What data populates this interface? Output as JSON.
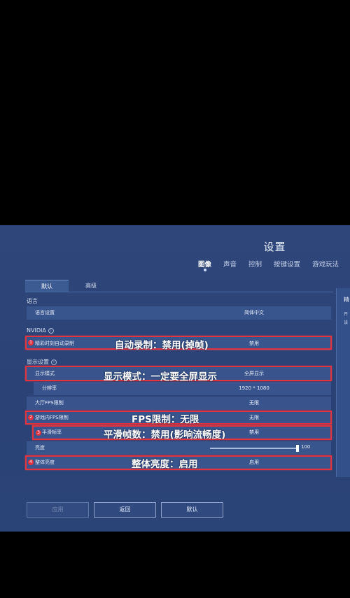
{
  "title": "设置",
  "top_tabs": [
    "图像",
    "声音",
    "控制",
    "按键设置",
    "游戏玩法"
  ],
  "sub_tabs": [
    "默认",
    "高级"
  ],
  "sections": {
    "language": "语言",
    "nvidia": "NVIDIA",
    "display": "显示设置"
  },
  "rows": {
    "language": {
      "label": "语言设置",
      "value": "简体中文"
    },
    "highlight_record": {
      "label": "精彩时刻自动录制",
      "value": "禁用"
    },
    "display_mode": {
      "label": "显示模式",
      "value": "全屏显示"
    },
    "resolution": {
      "label": "分辨率",
      "value": "1920 * 1080"
    },
    "lobby_fps": {
      "label": "大厅FPS限制",
      "value": "无限"
    },
    "ingame_fps": {
      "label": "游戏内FPS限制",
      "value": "无限"
    },
    "smooth_frame": {
      "label": "平滑帧率",
      "value": "禁用"
    },
    "brightness": {
      "label": "亮度",
      "value": "100",
      "level_fraction": 1.0
    },
    "overall_brightness": {
      "label": "整体亮度",
      "value": "启用"
    }
  },
  "annotations": {
    "a1": "自动录制：禁用(掉帧)",
    "a2": "显示模式：一定要全屏显示",
    "a3": "FPS限制：无限",
    "a4": "平滑帧数：禁用(影响流畅度)",
    "a5": "整体亮度：启用"
  },
  "badges": [
    "1",
    "2",
    "3",
    "4"
  ],
  "buttons": {
    "apply": "应用",
    "back": "返回",
    "default": "默认"
  },
  "right_panel": {
    "title": "精",
    "text": "开 该"
  },
  "colors": {
    "background": "#2e467a",
    "highlight": "#e2333f"
  }
}
